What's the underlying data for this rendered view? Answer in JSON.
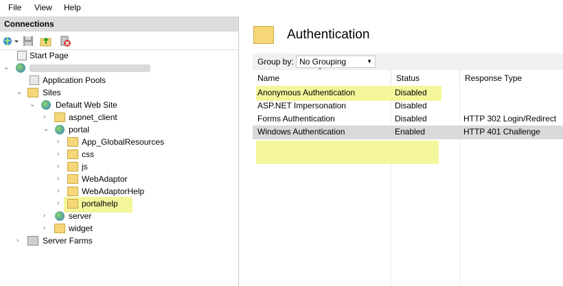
{
  "menu": {
    "file": "File",
    "view": "View",
    "help": "Help"
  },
  "connections": {
    "header": "Connections",
    "toolbar": [
      "connect-globe-icon",
      "save-icon",
      "up-folder-icon",
      "disconnect-icon"
    ],
    "tree": {
      "start_page": "Start Page",
      "server_name": "",
      "application_pools": "Application Pools",
      "sites": "Sites",
      "default_web_site": "Default Web Site",
      "aspnet_client": "aspnet_client",
      "portal": "portal",
      "app_globalresources": "App_GlobalResources",
      "css": "css",
      "js": "js",
      "webadaptor": "WebAdaptor",
      "webadaptorhelp": "WebAdaptorHelp",
      "portalhelp": "portalhelp",
      "server": "server",
      "widget": "widget",
      "server_farms": "Server Farms"
    }
  },
  "main": {
    "title": "Authentication",
    "group_by_label": "Group by:",
    "group_by_value": "No Grouping",
    "columns": {
      "name": "Name",
      "status": "Status",
      "response_type": "Response Type"
    },
    "rows": [
      {
        "name": "Anonymous Authentication",
        "status": "Disabled",
        "response": ""
      },
      {
        "name": "ASP.NET Impersonation",
        "status": "Disabled",
        "response": ""
      },
      {
        "name": "Forms Authentication",
        "status": "Disabled",
        "response": "HTTP 302 Login/Redirect"
      },
      {
        "name": "Windows Authentication",
        "status": "Enabled",
        "response": "HTTP 401 Challenge"
      }
    ]
  },
  "colors": {
    "highlight": "#f2f58a",
    "selected_row": "#d9d9d9",
    "header_bg": "#dcdcdc"
  }
}
